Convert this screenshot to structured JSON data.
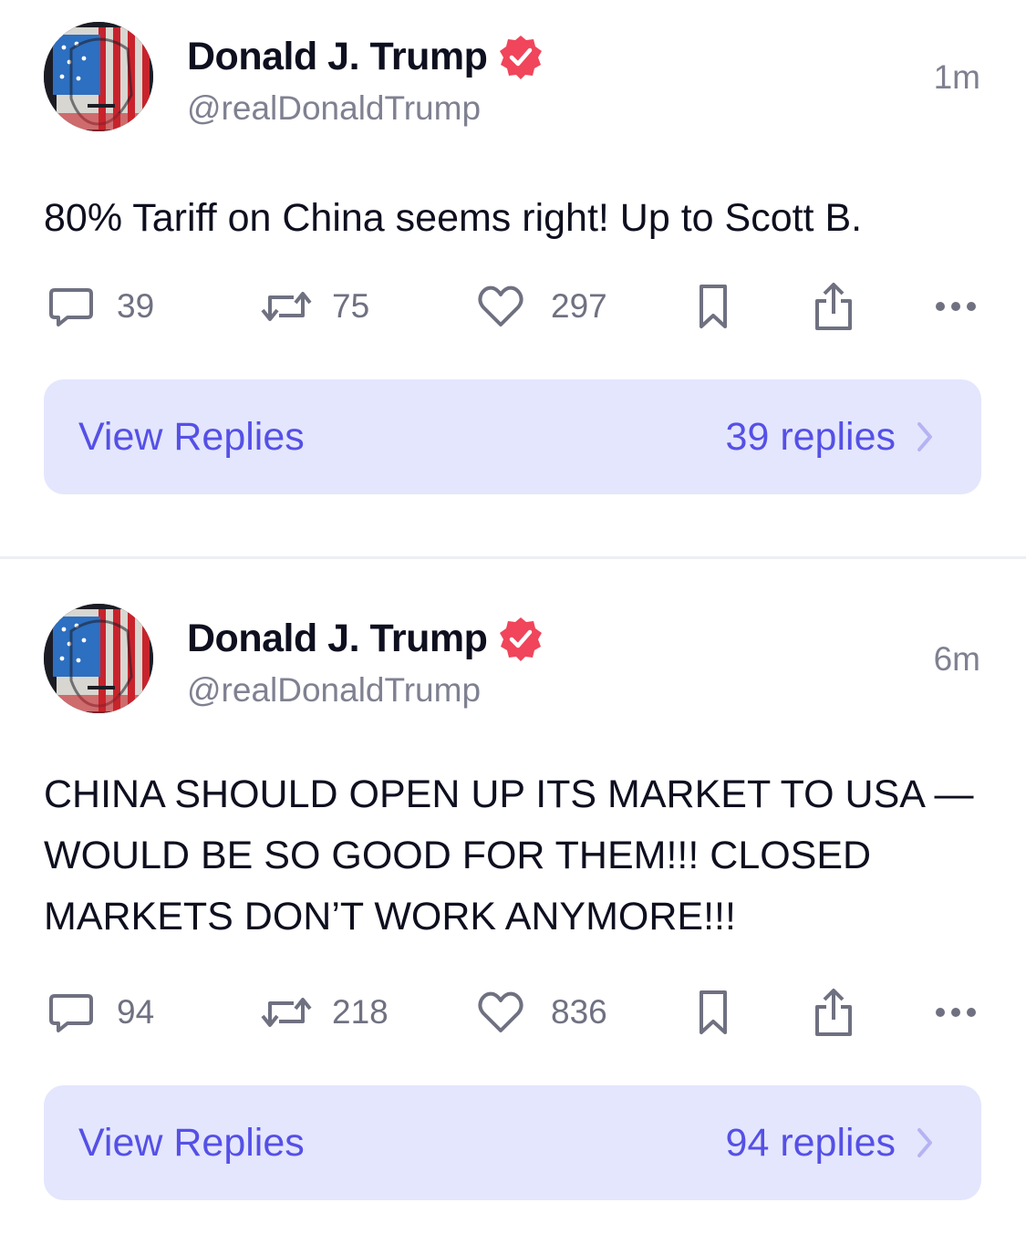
{
  "posts": [
    {
      "author": {
        "name": "Donald J. Trump",
        "handle": "@realDonaldTrump",
        "avatar": "avatar-icon",
        "verified_badge": "verified-badge-icon"
      },
      "time": "1m",
      "text": "80% Tariff on China seems right! Up to Scott B.",
      "stats": {
        "replies": "39",
        "reposts": "75",
        "likes": "297"
      },
      "view_replies_label": "View Replies",
      "replies_count_label": "39 replies"
    },
    {
      "author": {
        "name": "Donald J. Trump",
        "handle": "@realDonaldTrump",
        "avatar": "avatar-icon",
        "verified_badge": "verified-badge-icon"
      },
      "time": "6m",
      "text": "CHINA SHOULD OPEN UP ITS MARKET TO USA — WOULD BE SO GOOD FOR THEM!!! CLOSED MARKETS DON’T WORK ANYMORE!!!",
      "stats": {
        "replies": "94",
        "reposts": "218",
        "likes": "836"
      },
      "view_replies_label": "View Replies",
      "replies_count_label": "94 replies"
    }
  ],
  "icons": [
    "comment-icon",
    "repost-icon",
    "heart-icon",
    "bookmark-icon",
    "share-icon",
    "more-icon",
    "chevron-right-icon"
  ],
  "colors": {
    "accent": "#5550e6",
    "reply_bg": "#e4e6fd",
    "verified": "#f0455b",
    "muted": "#7f8191",
    "text": "#0e0f1f"
  }
}
